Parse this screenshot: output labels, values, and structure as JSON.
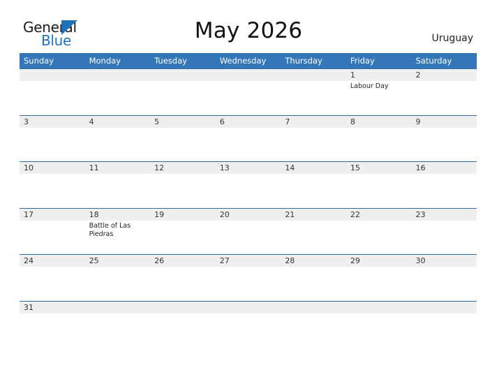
{
  "brand": {
    "name_top": "General",
    "name_bottom": "Blue",
    "triangle_icon": "triangle-icon",
    "accent_color": "#1f72b8"
  },
  "header": {
    "title": "May 2026",
    "country": "Uruguay"
  },
  "colors": {
    "header_blue": "#3477b8",
    "rule_blue": "#2e6da8",
    "band_gray": "#efefef",
    "text_dark": "#333333"
  },
  "calendar": {
    "weekdays": [
      "Sunday",
      "Monday",
      "Tuesday",
      "Wednesday",
      "Thursday",
      "Friday",
      "Saturday"
    ],
    "weeks": [
      [
        {
          "num": "",
          "event": ""
        },
        {
          "num": "",
          "event": ""
        },
        {
          "num": "",
          "event": ""
        },
        {
          "num": "",
          "event": ""
        },
        {
          "num": "",
          "event": ""
        },
        {
          "num": "1",
          "event": "Labour Day"
        },
        {
          "num": "2",
          "event": ""
        }
      ],
      [
        {
          "num": "3",
          "event": ""
        },
        {
          "num": "4",
          "event": ""
        },
        {
          "num": "5",
          "event": ""
        },
        {
          "num": "6",
          "event": ""
        },
        {
          "num": "7",
          "event": ""
        },
        {
          "num": "8",
          "event": ""
        },
        {
          "num": "9",
          "event": ""
        }
      ],
      [
        {
          "num": "10",
          "event": ""
        },
        {
          "num": "11",
          "event": ""
        },
        {
          "num": "12",
          "event": ""
        },
        {
          "num": "13",
          "event": ""
        },
        {
          "num": "14",
          "event": ""
        },
        {
          "num": "15",
          "event": ""
        },
        {
          "num": "16",
          "event": ""
        }
      ],
      [
        {
          "num": "17",
          "event": ""
        },
        {
          "num": "18",
          "event": "Battle of Las Piedras"
        },
        {
          "num": "19",
          "event": ""
        },
        {
          "num": "20",
          "event": ""
        },
        {
          "num": "21",
          "event": ""
        },
        {
          "num": "22",
          "event": ""
        },
        {
          "num": "23",
          "event": ""
        }
      ],
      [
        {
          "num": "24",
          "event": ""
        },
        {
          "num": "25",
          "event": ""
        },
        {
          "num": "26",
          "event": ""
        },
        {
          "num": "27",
          "event": ""
        },
        {
          "num": "28",
          "event": ""
        },
        {
          "num": "29",
          "event": ""
        },
        {
          "num": "30",
          "event": ""
        }
      ],
      [
        {
          "num": "31",
          "event": ""
        },
        {
          "num": "",
          "event": ""
        },
        {
          "num": "",
          "event": ""
        },
        {
          "num": "",
          "event": ""
        },
        {
          "num": "",
          "event": ""
        },
        {
          "num": "",
          "event": ""
        },
        {
          "num": "",
          "event": ""
        }
      ]
    ]
  }
}
